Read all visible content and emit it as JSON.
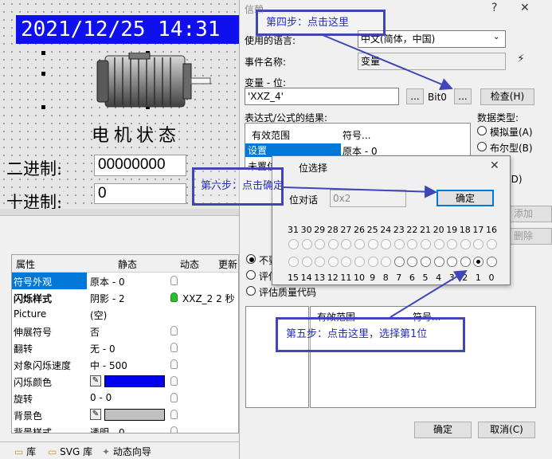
{
  "canvas": {
    "clock": "2021/12/25  14:31",
    "motor_title": "电机状态",
    "binary_label": "二进制:",
    "binary_value": "00000000",
    "decimal_label": "十进制:",
    "decimal_value": "0"
  },
  "props": {
    "headers": [
      "属性",
      "静态",
      "动态",
      "更新"
    ],
    "rows": [
      {
        "name": "符号外观",
        "value": "原本 - 0",
        "dynamic": ""
      },
      {
        "name": "闪烁样式",
        "value": "阴影 - 2",
        "dynamic": "XXZ_2  2 秒"
      },
      {
        "name": "Picture",
        "value": "(空)",
        "dynamic": ""
      },
      {
        "name": "伸展符号",
        "value": "否",
        "dynamic": ""
      },
      {
        "name": "翻转",
        "value": "无 - 0",
        "dynamic": ""
      },
      {
        "name": "对象闪烁速度",
        "value": "中 - 500",
        "dynamic": ""
      },
      {
        "name": "闪烁颜色",
        "value": "",
        "dynamic": ""
      },
      {
        "name": "旋转",
        "value": "0 - 0",
        "dynamic": ""
      },
      {
        "name": "背景色",
        "value": "",
        "dynamic": ""
      },
      {
        "name": "背景样式",
        "value": "透明 - 0",
        "dynamic": ""
      }
    ],
    "flash_color": "#0000ee",
    "bg_color": "#c0c0c0"
  },
  "bottom_tabs": [
    "库",
    "SVG 库",
    "动态向导"
  ],
  "dialog": {
    "title": "信赖",
    "language_label": "使用的语言:",
    "language_value": "中文(简体，中国)",
    "event_label": "事件名称:",
    "event_value": "变量",
    "var_label": "变量 - 位:",
    "var_value": "'XXZ_4'",
    "browse1": "...",
    "bit_label": "Bit0",
    "browse2": "...",
    "check_button": "检查(H)",
    "result_label": "表达式/公式的结果:",
    "result_cols": [
      "有效范围",
      "符号..."
    ],
    "result_rows": [
      {
        "range": "设置",
        "symbol": "原本 - 0"
      },
      {
        "range": "未置位",
        "symbol": ""
      }
    ],
    "datatype_label": "数据类型:",
    "datatypes": [
      "模拟量(A)",
      "布尔型(B)",
      "位(I)",
      "(D)"
    ],
    "add_button": "添加",
    "delete_button": "删除",
    "eval_options": [
      "不要...",
      "评估...",
      "评估质量代码"
    ],
    "lower_cols": [
      "有效范围",
      "符号..."
    ],
    "ok_button": "确定",
    "cancel_button": "取消(C)"
  },
  "bitdialog": {
    "title": "位选择",
    "word_label": "位对话",
    "word_value": "0x2",
    "ok_button": "确定",
    "top_numbers": [
      "31",
      "30",
      "29",
      "28",
      "27",
      "26",
      "25",
      "24",
      "23",
      "22",
      "21",
      "20",
      "19",
      "18",
      "17",
      "16"
    ],
    "bottom_numbers": [
      "15",
      "14",
      "13",
      "12",
      "11",
      "10",
      "9",
      "8",
      "7",
      "6",
      "5",
      "4",
      "3",
      "2",
      "1",
      "0"
    ],
    "selected_bit": 1
  },
  "annotations": {
    "step4": "第四步：点击这里",
    "step5": "第五步：点击这里，选择第1位",
    "step6": "第六步：点击确定"
  },
  "colors": {
    "clock_bg": "#1010ee",
    "highlight": "#0078d7",
    "callout": "#3f47b8"
  }
}
